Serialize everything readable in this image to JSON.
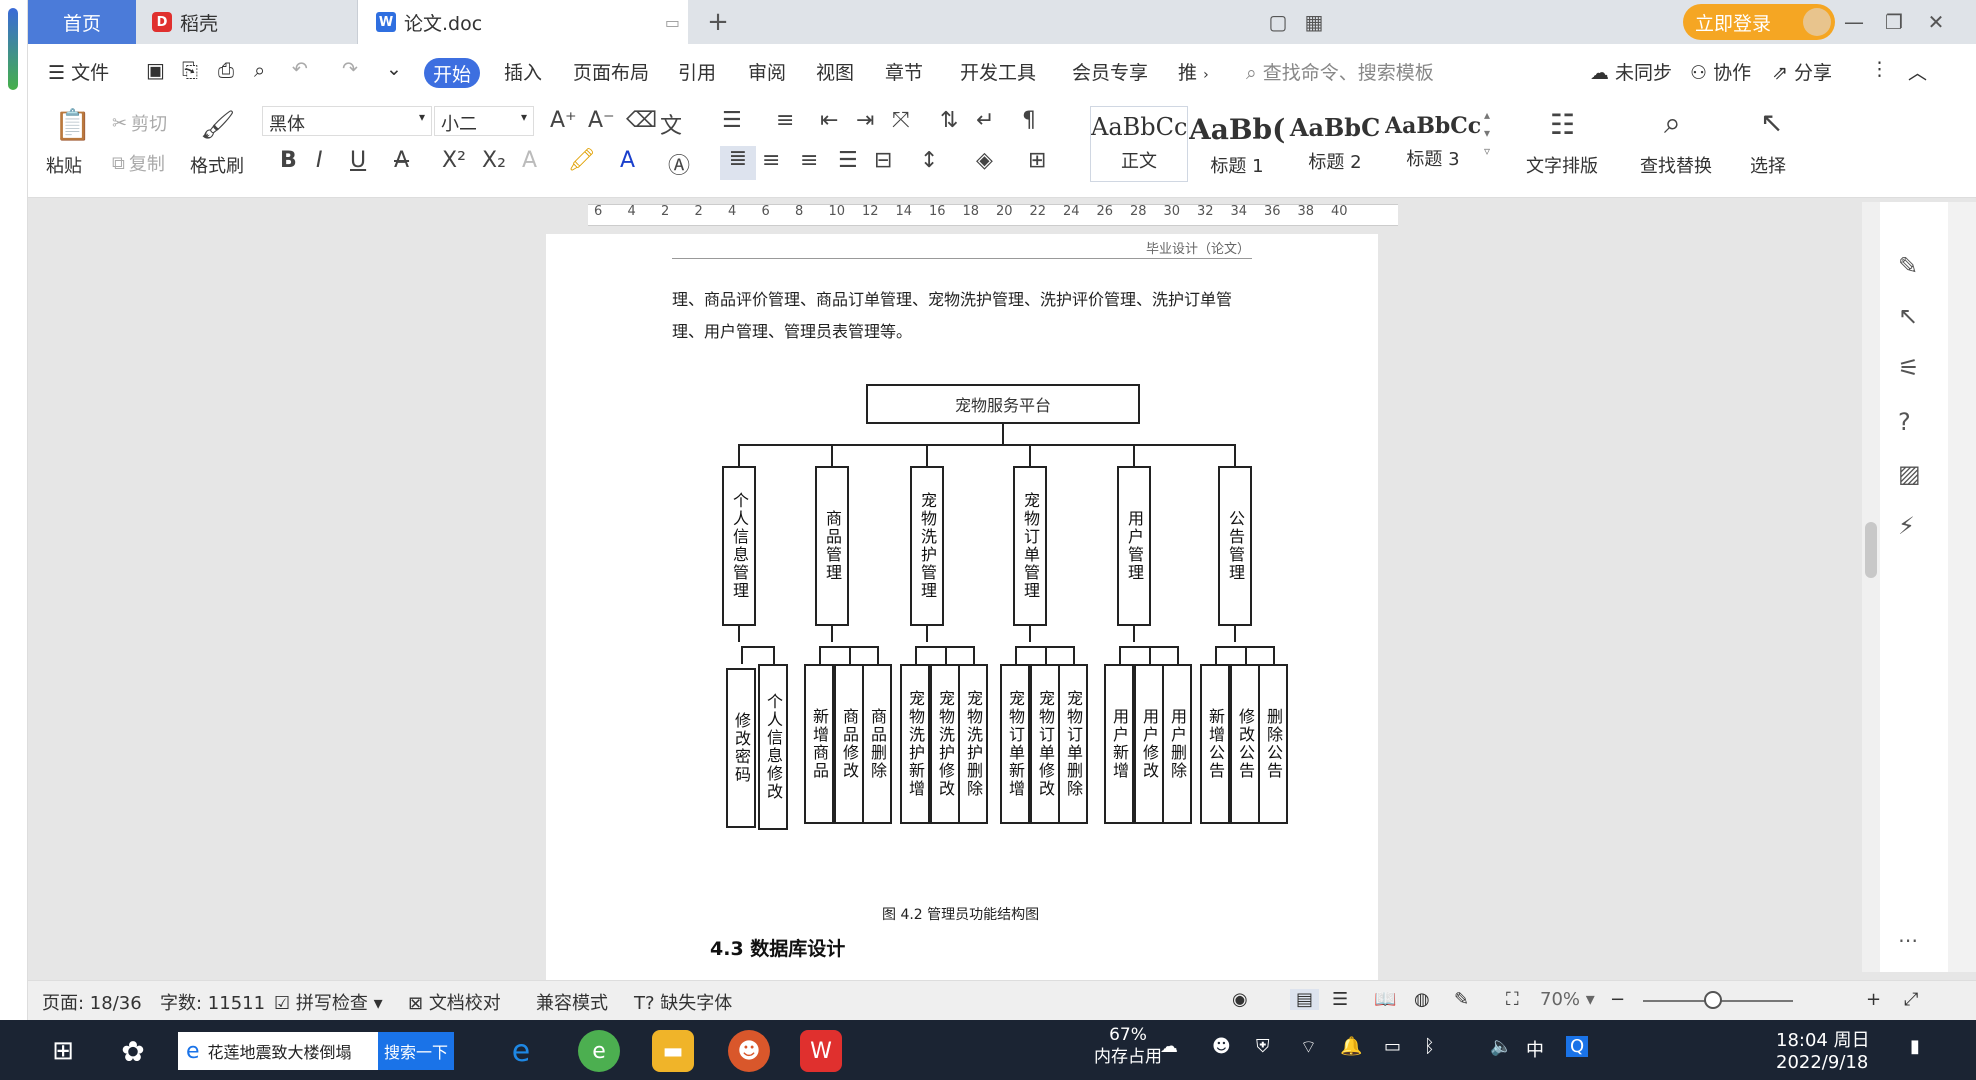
{
  "titlebar": {
    "tabs": [
      "首页",
      "稻壳",
      "论文.doc"
    ],
    "login": "立即登录"
  },
  "menubar": {
    "file": "文件",
    "items": [
      "开始",
      "插入",
      "页面布局",
      "引用",
      "审阅",
      "视图",
      "章节",
      "开发工具",
      "会员专享",
      "推"
    ],
    "search_placeholder": "查找命令、搜索模板",
    "sync": "未同步",
    "collab": "协作",
    "share": "分享"
  },
  "ribbon": {
    "paste": "粘贴",
    "cut": "剪切",
    "copy": "复制",
    "format_painter": "格式刷",
    "font": "黑体",
    "size": "小二",
    "styles": [
      {
        "preview": "AaBbCcI",
        "label": "正文"
      },
      {
        "preview": "AaBb(",
        "label": "标题 1"
      },
      {
        "preview": "AaBbC",
        "label": "标题 2"
      },
      {
        "preview": "AaBbCcl",
        "label": "标题 3"
      }
    ],
    "text_layout": "文字排版",
    "find_replace": "查找替换",
    "select": "选择"
  },
  "ruler": {
    "ticks": [
      "6",
      "4",
      "2",
      "2",
      "4",
      "6",
      "8",
      "10",
      "12",
      "14",
      "16",
      "18",
      "20",
      "22",
      "24",
      "26",
      "28",
      "30",
      "32",
      "34",
      "36",
      "38",
      "40"
    ]
  },
  "document": {
    "header": "毕业设计（论文）",
    "para1": "理、商品评价管理、商品订单管理、宠物洗护管理、洗护评价管理、洗护订单管",
    "para2": "理、用户管理、管理员表管理等。",
    "root": "宠物服务平台",
    "modules": [
      {
        "name": "个人信息管理",
        "children": [
          "修改密码",
          "个人信息修改"
        ]
      },
      {
        "name": "商品管理",
        "children": [
          "新增商品",
          "商品修改",
          "商品删除"
        ]
      },
      {
        "name": "宠物洗护管理",
        "children": [
          "宠物洗护新增",
          "宠物洗护修改",
          "宠物洗护删除"
        ]
      },
      {
        "name": "宠物订单管理",
        "children": [
          "宠物订单新增",
          "宠物订单修改",
          "宠物订单删除"
        ]
      },
      {
        "name": "用户管理",
        "children": [
          "用户新增",
          "用户修改",
          "用户删除"
        ]
      },
      {
        "name": "公告管理",
        "children": [
          "新增公告",
          "修改公告",
          "删除公告"
        ]
      }
    ],
    "caption": "图 4.2  管理员功能结构图",
    "section": "4.3  数据库设计"
  },
  "statusbar": {
    "page": "页面: 18/36",
    "words": "字数: 11511",
    "spell": "拼写检查",
    "proof": "文档校对",
    "compat": "兼容模式",
    "missing_font": "缺失字体",
    "zoom": "70%"
  },
  "taskbar": {
    "search_text": "花莲地震致大楼倒塌",
    "search_button": "搜索一下",
    "memory_pct": "67%",
    "memory_label": "内存占用",
    "ime": "中",
    "time": "18:04 周日",
    "date": "2022/9/18"
  }
}
